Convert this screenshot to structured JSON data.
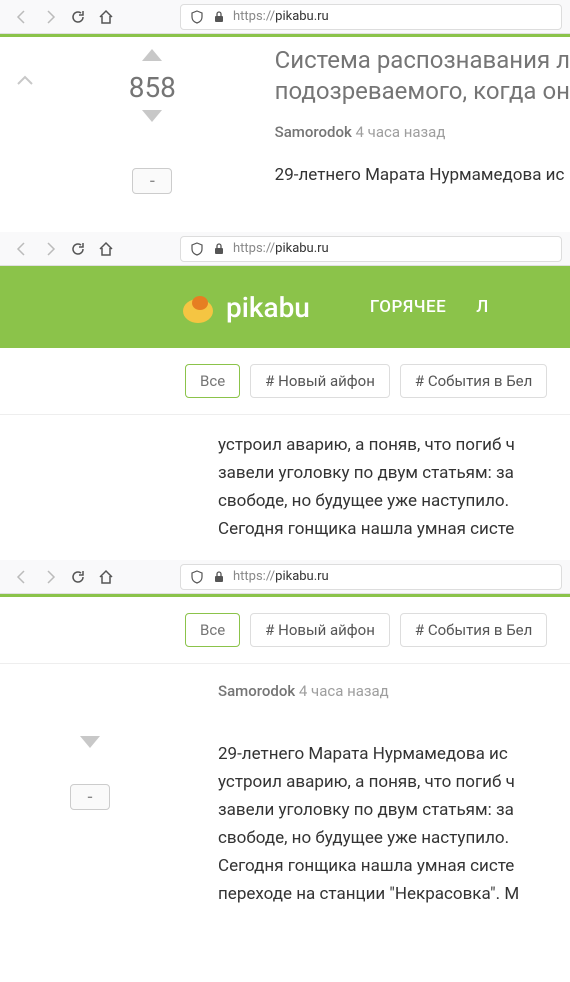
{
  "url": {
    "protocol": "https://",
    "domain": "pikabu.ru"
  },
  "section1": {
    "vote_count": "858",
    "save_label": "-",
    "title": "Система распознавания л\nподозреваемого, когда он",
    "author": "Samorodok",
    "time": "4 часа назад",
    "body": "29-летнего Марата Нурмамедова ис"
  },
  "section2": {
    "logo_text": "pikabu",
    "nav_hot": "ГОРЯЧЕЕ",
    "nav_l": "Л",
    "tags": {
      "all": "Все",
      "iphone": "# Новый айфон",
      "belarus": "# События в Бел"
    },
    "body_lines": [
      "устроил аварию, а поняв, что погиб ч",
      "завели уголовку по двум статьям: за",
      "свободе, но будущее уже наступило.",
      "Сегодня гонщика нашла умная систе"
    ]
  },
  "section3": {
    "save_label": "-",
    "tags": {
      "all": "Все",
      "iphone": "# Новый айфон",
      "belarus": "# События в Бел"
    },
    "author": "Samorodok",
    "time": "4 часа назад",
    "body_lines": [
      "29-летнего Марата Нурмамедова ис",
      "устроил аварию, а поняв, что погиб ч",
      "завели уголовку по двум статьям: за",
      "свободе, но будущее уже наступило.",
      "Сегодня гонщика нашла умная систе",
      "переходе на станции \"Некрасовка\". М"
    ]
  }
}
